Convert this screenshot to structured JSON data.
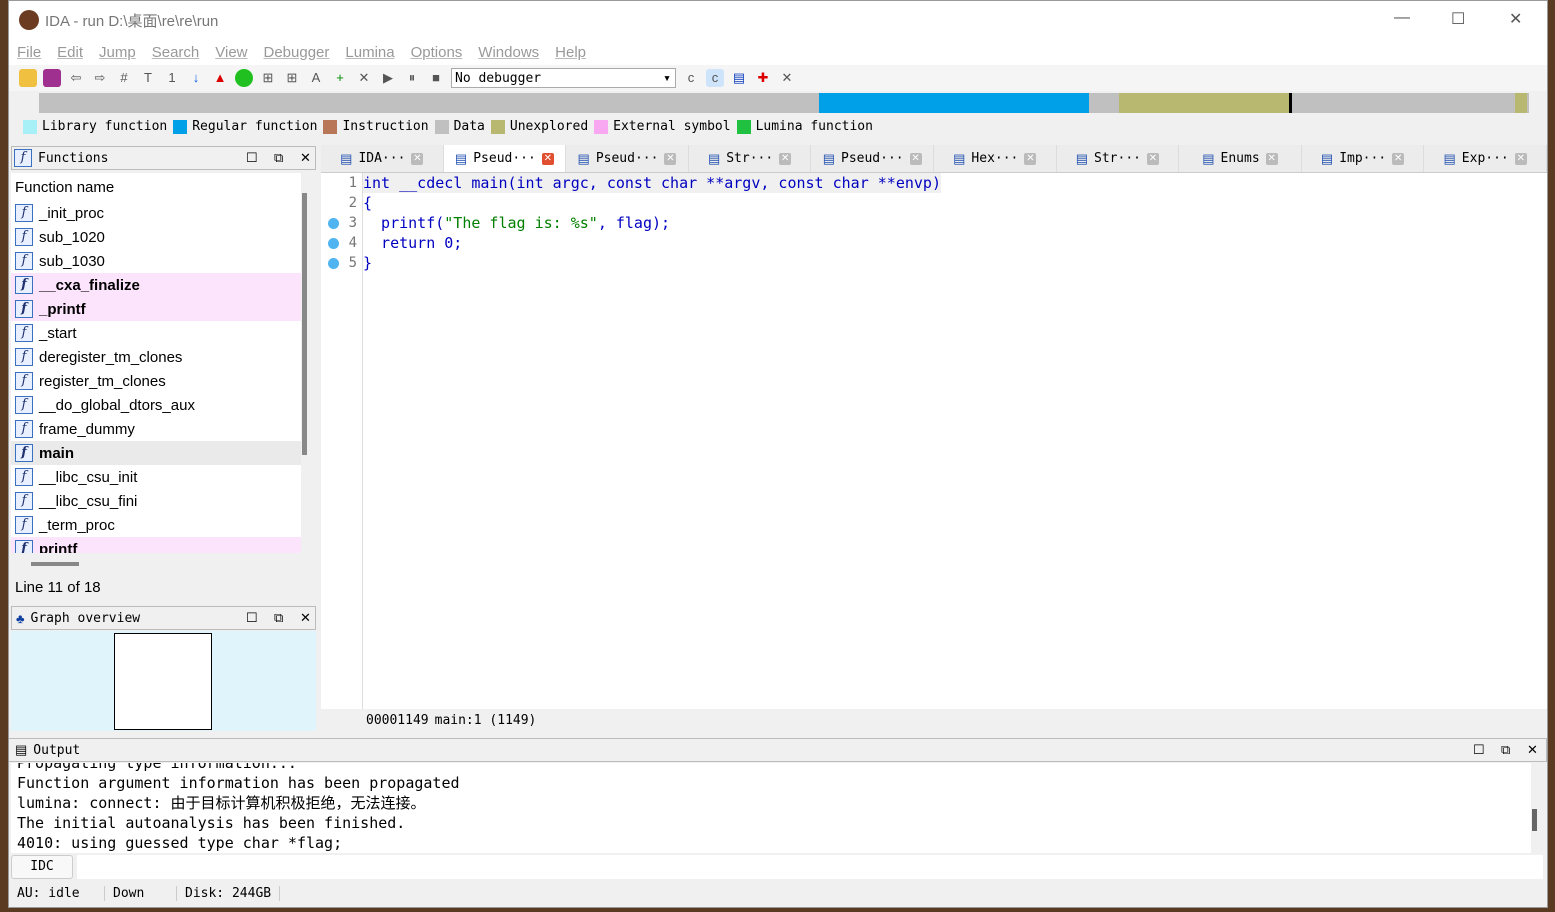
{
  "window": {
    "title": "IDA - run D:\\桌面\\re\\re\\run"
  },
  "menu": [
    "File",
    "Edit",
    "Jump",
    "Search",
    "View",
    "Debugger",
    "Lumina",
    "Options",
    "Windows",
    "Help"
  ],
  "toolbar": {
    "debugger_select": "No debugger"
  },
  "legend": [
    {
      "label": "Library function",
      "color": "#a8f0f8"
    },
    {
      "label": "Regular function",
      "color": "#00a0e8"
    },
    {
      "label": "Instruction",
      "color": "#b87858"
    },
    {
      "label": "Data",
      "color": "#c0c0c0"
    },
    {
      "label": "Unexplored",
      "color": "#b8b870"
    },
    {
      "label": "External symbol",
      "color": "#f8a8f0"
    },
    {
      "label": "Lumina function",
      "color": "#20c040"
    }
  ],
  "functions": {
    "title": "Functions",
    "column": "Function name",
    "items": [
      {
        "name": "_init_proc"
      },
      {
        "name": "sub_1020"
      },
      {
        "name": "sub_1030"
      },
      {
        "name": "__cxa_finalize",
        "external": true
      },
      {
        "name": "_printf",
        "external": true
      },
      {
        "name": "_start"
      },
      {
        "name": "deregister_tm_clones"
      },
      {
        "name": "register_tm_clones"
      },
      {
        "name": "__do_global_dtors_aux"
      },
      {
        "name": "frame_dummy"
      },
      {
        "name": "main",
        "selected": true
      },
      {
        "name": "__libc_csu_init"
      },
      {
        "name": "__libc_csu_fini"
      },
      {
        "name": "_term_proc"
      },
      {
        "name": "printf",
        "external": true
      }
    ],
    "status": "Line 11 of 18"
  },
  "graph_overview": {
    "title": "Graph overview"
  },
  "tabs": [
    {
      "label": "IDA···"
    },
    {
      "label": "Pseud···",
      "active": true
    },
    {
      "label": "Pseud···"
    },
    {
      "label": "Str···"
    },
    {
      "label": "Pseud···"
    },
    {
      "label": "Hex···"
    },
    {
      "label": "Str···"
    },
    {
      "label": "Enums"
    },
    {
      "label": "Imp···"
    },
    {
      "label": "Exp···"
    }
  ],
  "code": {
    "lines": [
      {
        "n": "1",
        "text": "int __cdecl main(int argc, const char **argv, const char **envp)",
        "bp": false
      },
      {
        "n": "2",
        "text": "{",
        "bp": false
      },
      {
        "n": "3",
        "pre": "  printf(",
        "str": "\"The flag is: %s\"",
        "post": ", flag);",
        "bp": true
      },
      {
        "n": "4",
        "text": "  return 0;",
        "bp": true
      },
      {
        "n": "5",
        "text": "}",
        "bp": true
      }
    ],
    "status_addr": "00001149",
    "status_loc": "main:1 (1149)"
  },
  "output": {
    "title": "Output",
    "lines": [
      "Propagating type information...",
      "Function argument information has been propagated",
      "lumina: connect: 由于目标计算机积极拒绝，无法连接。",
      "The initial autoanalysis has been finished.",
      "4010: using guessed type char *flag;"
    ],
    "idc_button": "IDC"
  },
  "status": {
    "au": "AU:  idle",
    "dir": "Down",
    "disk": "Disk: 244GB"
  }
}
